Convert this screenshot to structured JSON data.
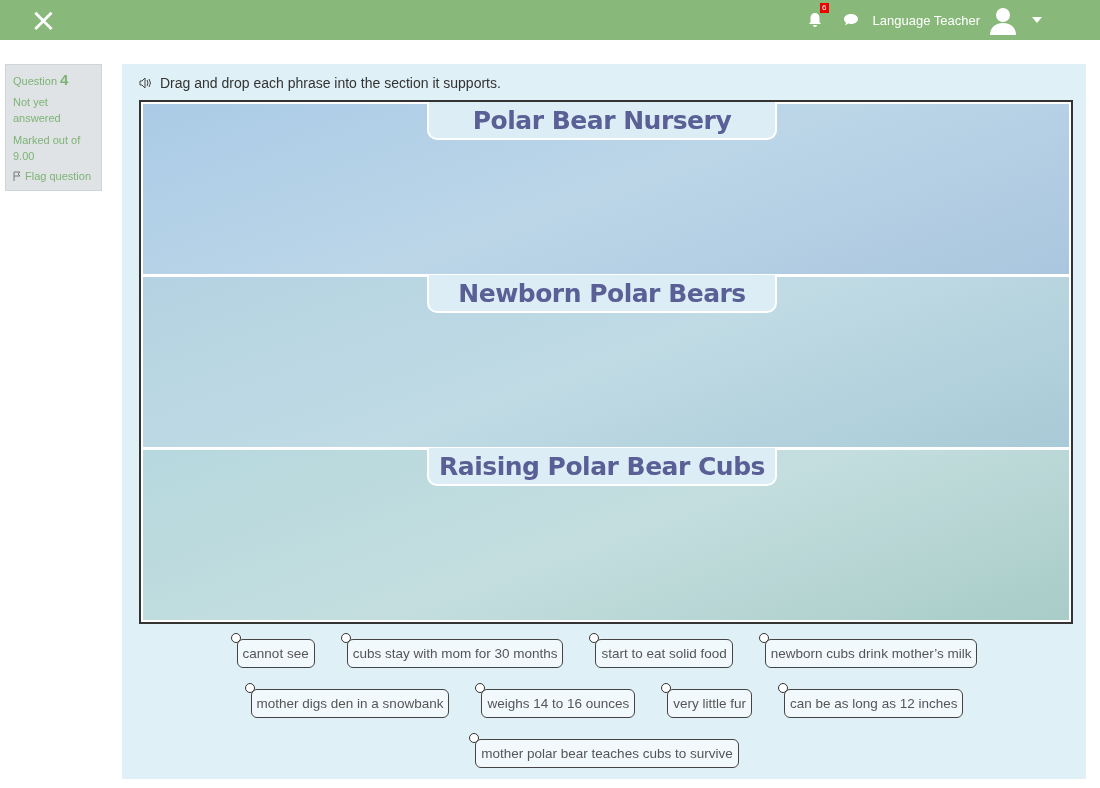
{
  "header": {
    "close": "×",
    "notifications": {
      "count": "6"
    },
    "user": {
      "name": "Language Teacher"
    }
  },
  "question_info": {
    "label": "Question",
    "number": "4",
    "status": "Not yet answered",
    "marks": "Marked out of 9.00",
    "flag": "Flag question"
  },
  "instruction": "Drag and drop each phrase into the section it supports.",
  "sections": [
    {
      "title": "Polar Bear Nursery"
    },
    {
      "title": "Newborn Polar Bears"
    },
    {
      "title": "Raising Polar Bear Cubs"
    }
  ],
  "phrase_rows": [
    [
      "cannot see",
      "cubs stay with mom for 30 months",
      "start to eat solid food",
      "newborn cubs drink mother’s milk"
    ],
    [
      "mother digs den in a snowbank",
      "weighs 14 to 16 ounces",
      "very little fur",
      "can be as long as 12 inches"
    ],
    [
      "mother polar bear teaches cubs to survive"
    ]
  ]
}
